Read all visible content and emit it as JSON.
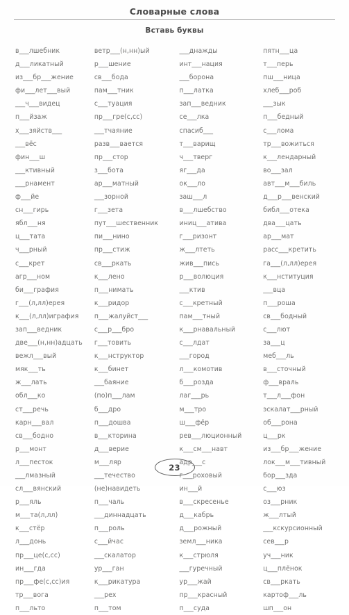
{
  "header": {
    "title": "Словарные слова",
    "subtitle": "Вставь буквы"
  },
  "footer": {
    "page_number": "23"
  },
  "columns": [
    {
      "id": "column-1",
      "words": [
        "в___лшебник",
        "д___ликатный",
        "из___бр___жение",
        "фи___лет___вый",
        "___ч___видец",
        "п___йзаж",
        "х___зяйств___",
        "___вёс",
        "фин___ш",
        "___ктивный",
        "___рнамент",
        "ф___йе",
        "сн___гирь",
        "ябл___ня",
        "ц___тата",
        "ч___рный",
        "с___крет",
        "агр___ном",
        "би___графия",
        "г___(л,лл)ерея",
        "к___(л,лл)играфия",
        "зап___ведник",
        "две___(н,нн)адцать",
        "вежл___вый",
        "мяк___ть",
        "ж___лать",
        "обл___ко",
        "ст___речь",
        "карн___вал",
        "св___бодно",
        "р___монт",
        "л___песток",
        "___лмазный",
        "сл___вянский",
        "р___яль",
        "м___та(л,лл)",
        "к___стёр",
        "л___донь",
        "пр___це(с,сс)",
        "ин___гда",
        "пр___фе(с,сс)ия",
        "тр___вога",
        "п___льто"
      ]
    },
    {
      "id": "column-2",
      "words": [
        "ветр___(н,нн)ый",
        "р___шение",
        "св___бода",
        "пам___тник",
        "с___туация",
        "пр___гре(с,сс)",
        "___тчаяние",
        "разв___вается",
        "пр___стор",
        "з___бота",
        "ар___матный",
        "___зорной",
        "г___зета",
        "пут___шественник",
        "пи___нино",
        "пр___стиж",
        "св___ркать",
        "к___лено",
        "п___нимать",
        "к___ридор",
        "п___жалуйст___",
        "с___р___бро",
        "г___товить",
        "к___нструктор",
        "к___бинет",
        "___баяние",
        "(по)п___лам",
        "б___дро",
        "п___дошва",
        "в___кторина",
        "д___верие",
        "м___ляр",
        "___течество",
        "(не)навидеть",
        "п___чаль",
        "___диннадцать",
        "п___роль",
        "с___йчас",
        "___скалатор",
        "ур___ган",
        "к___рикатура",
        "___рех",
        "п___том"
      ]
    },
    {
      "id": "column-3",
      "words": [
        "___днажды",
        "инт___нация",
        "___борона",
        "п___латка",
        "зап___ведник",
        "се___лка",
        "спасиб___",
        "т___варищ",
        "ч___тверг",
        "яг___да",
        "ок___ло",
        "заш___л",
        "в___лшебство",
        "иниц___атива",
        "г___ризонт",
        "ж___лтеть",
        "жив___пись",
        "р___волюция",
        "___ктив",
        "с___кретный",
        "пам___тный",
        "к___рнавальный",
        "с___лдат",
        "___город",
        "л___комотив",
        "б___розда",
        "лаг___рь",
        "м___тро",
        "ш___фёр",
        "рев___люционный",
        "к___см___навт",
        "адр___с",
        "г___роховый",
        "ин___й",
        "в___скресенье",
        "д___кабрь",
        "д___рожный",
        "земл___ника",
        "к___стрюля",
        "___гуречный",
        "ур___жай",
        "пр___красный",
        "п___суда"
      ]
    },
    {
      "id": "column-4",
      "words": [
        "пятн___ца",
        "т___перь",
        "пш___ница",
        "хлеб___роб",
        "___зык",
        "п___бедный",
        "с___лома",
        "тр___вожиться",
        "к___лендарный",
        "во___зал",
        "авт___м___биль",
        "д___р___венский",
        "библ___отека",
        "два___цать",
        "ар___мат",
        "расс___кретить",
        "га___(л,лл)ерея",
        "к___нституция",
        "___вца",
        "п___роша",
        "св___бодный",
        "с___лют",
        "за___ц",
        "меб___ль",
        "в___сточный",
        "ф___враль",
        "т___л___фон",
        "эскалат___рный",
        "об___рона",
        "ц___рк",
        "из___бр___жение",
        "лок___м___тивный",
        "бор___зда",
        "с___юз",
        "оз___рник",
        "ж___лтый",
        "___кскурсионный",
        "сев___р",
        "уч___ник",
        "ц___плёнок",
        "св___ркать",
        "картоф___ль",
        "шп___он"
      ]
    }
  ]
}
